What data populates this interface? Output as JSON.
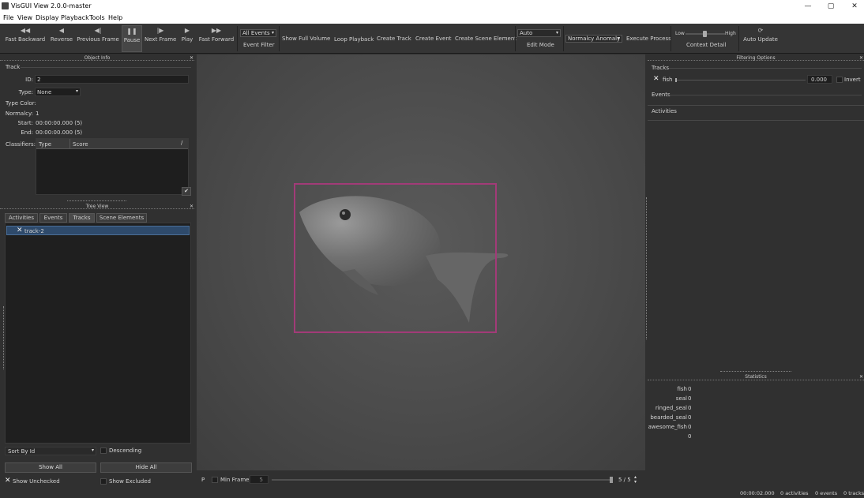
{
  "window": {
    "title": "VisGUI View 2.0.0-master",
    "controls": [
      "—",
      "▢",
      "✕"
    ]
  },
  "menu": [
    "File",
    "View",
    "Display",
    "Playback",
    "Tools",
    "Help"
  ],
  "toolbar": {
    "playback": [
      {
        "icon": "◀◀",
        "label": "Fast Backward"
      },
      {
        "icon": "◀",
        "label": "Reverse"
      },
      {
        "icon": "◀|",
        "label": "Previous Frame"
      },
      {
        "icon": "❚❚",
        "label": "Pause"
      },
      {
        "icon": "|▶",
        "label": "Next Frame"
      },
      {
        "icon": "▶",
        "label": "Play"
      },
      {
        "icon": "▶▶",
        "label": "Fast Forward"
      }
    ],
    "event_select": "All Events",
    "event_filter": "Event Filter",
    "show_full_volume": "Show Full Volume",
    "loop_playback": "Loop Playback",
    "create_track": "Create Track",
    "create_event": "Create Event",
    "create_scene_element": "Create Scene Element",
    "mode_select": "Auto",
    "edit_mode": "Edit Mode",
    "normalcy_select": "Normalcy Anomaly",
    "execute_process": "Execute Process",
    "context_low": "Low",
    "context_high": "High",
    "context_detail": "Context Detail",
    "auto_update_icon": "⟳",
    "auto_update": "Auto Update"
  },
  "object_info": {
    "header": "Object Info",
    "section": "Track",
    "id_label": "ID:",
    "id_value": "2",
    "type_label": "Type:",
    "type_value": "None",
    "type_color_label": "Type Color:",
    "normalcy_label": "Normalcy:",
    "normalcy_value": "1",
    "start_label": "Start:",
    "start_value": "00:00:00.000  (5)",
    "end_label": "End:",
    "end_value": "00:00:00.000  (5)",
    "classifiers_label": "Classifiers:",
    "classifier_columns": [
      "Type",
      "Score"
    ],
    "apply_icon": "✔"
  },
  "tree_view": {
    "header": "Tree View",
    "tabs": [
      "Activities",
      "Events",
      "Tracks",
      "Scene Elements"
    ],
    "items": [
      {
        "checked": "✕",
        "label": "track-2"
      }
    ],
    "sort_select": "Sort By Id",
    "descending": "Descending",
    "show_all": "Show All",
    "hide_all": "Hide All",
    "show_unchecked": "Show Unchecked",
    "show_excluded": "Show Excluded"
  },
  "filtering": {
    "header": "Filtering Options",
    "tracks_label": "Tracks",
    "track_filter": {
      "checked": "✕",
      "name": "fish",
      "value": "0.000"
    },
    "invert": "Invert",
    "events_label": "Events",
    "activities_label": "Activities"
  },
  "statistics": {
    "header": "Statistics",
    "rows": [
      {
        "label": "fish",
        "value": "0"
      },
      {
        "label": "seal",
        "value": "0"
      },
      {
        "label": "ringed_seal",
        "value": "0"
      },
      {
        "label": "bearded_seal",
        "value": "0"
      },
      {
        "label": "awesome_fish",
        "value": "0"
      },
      {
        "label": "",
        "value": "0"
      }
    ]
  },
  "bottom_bar": {
    "p_label": "P",
    "min_frame": "Min Frame",
    "min_frame_value": "5",
    "frame_counter": "5 / 5"
  },
  "status_bar": {
    "time": "00:00:02.000",
    "activities": "0 activities",
    "events": "0 events",
    "tracks": "0 tracks"
  },
  "colors": {
    "bbox": "#a23b78",
    "selection": "#2e4a6b",
    "background": "#303030"
  }
}
